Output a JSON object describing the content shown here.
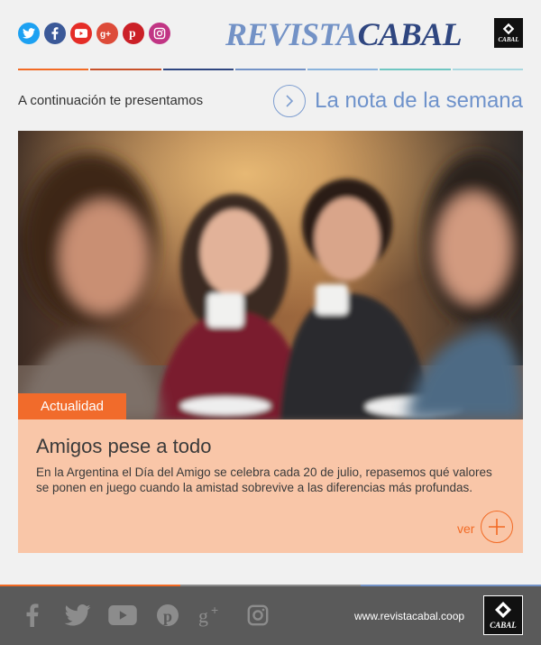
{
  "header": {
    "social": [
      {
        "name": "twitter",
        "icon": "twitter-icon",
        "color": "#1da1f2"
      },
      {
        "name": "facebook",
        "icon": "facebook-icon",
        "color": "#3b5998"
      },
      {
        "name": "youtube",
        "icon": "youtube-icon",
        "color": "#e52d27"
      },
      {
        "name": "googleplus",
        "icon": "google-plus-icon",
        "color": "#dd4b39"
      },
      {
        "name": "pinterest",
        "icon": "pinterest-icon",
        "color": "#cb2027"
      },
      {
        "name": "instagram",
        "icon": "instagram-icon",
        "color": "#c13584"
      }
    ],
    "brand_part1": "REVISTA",
    "brand_part2": "CABAL",
    "logo_text": "CABAL",
    "rule_colors": [
      "#f26a24",
      "#c8512a",
      "#2f4680",
      "#7392c6",
      "#8ab3dc",
      "#6fc6c2",
      "#a9d8e0"
    ]
  },
  "intro": {
    "text": "A continuación te presentamos",
    "nota_title": "La nota de la semana"
  },
  "article": {
    "tag": "Actualidad",
    "title": "Amigos pese a todo",
    "body": "En la Argentina el Día del Amigo se celebra cada 20 de julio, repasemos qué valores se ponen en juego cuando la amistad sobrevive a las diferencias más profundas.",
    "ver_label": "ver"
  },
  "footer": {
    "url": "www.revistacabal.coop",
    "logo_text": "CABAL",
    "icons": [
      "facebook-icon",
      "twitter-icon",
      "youtube-icon",
      "pinterest-icon",
      "google-plus-icon",
      "instagram-icon"
    ],
    "rule_colors": [
      "#f26a24",
      "#8a8a8a",
      "#7392c6"
    ]
  },
  "colors": {
    "accent_orange": "#f26a24",
    "brand_blue": "#2f4680",
    "light_blue": "#7392c6",
    "card_bg": "#f9c6a8",
    "footer_bg": "#5a5a5a"
  }
}
